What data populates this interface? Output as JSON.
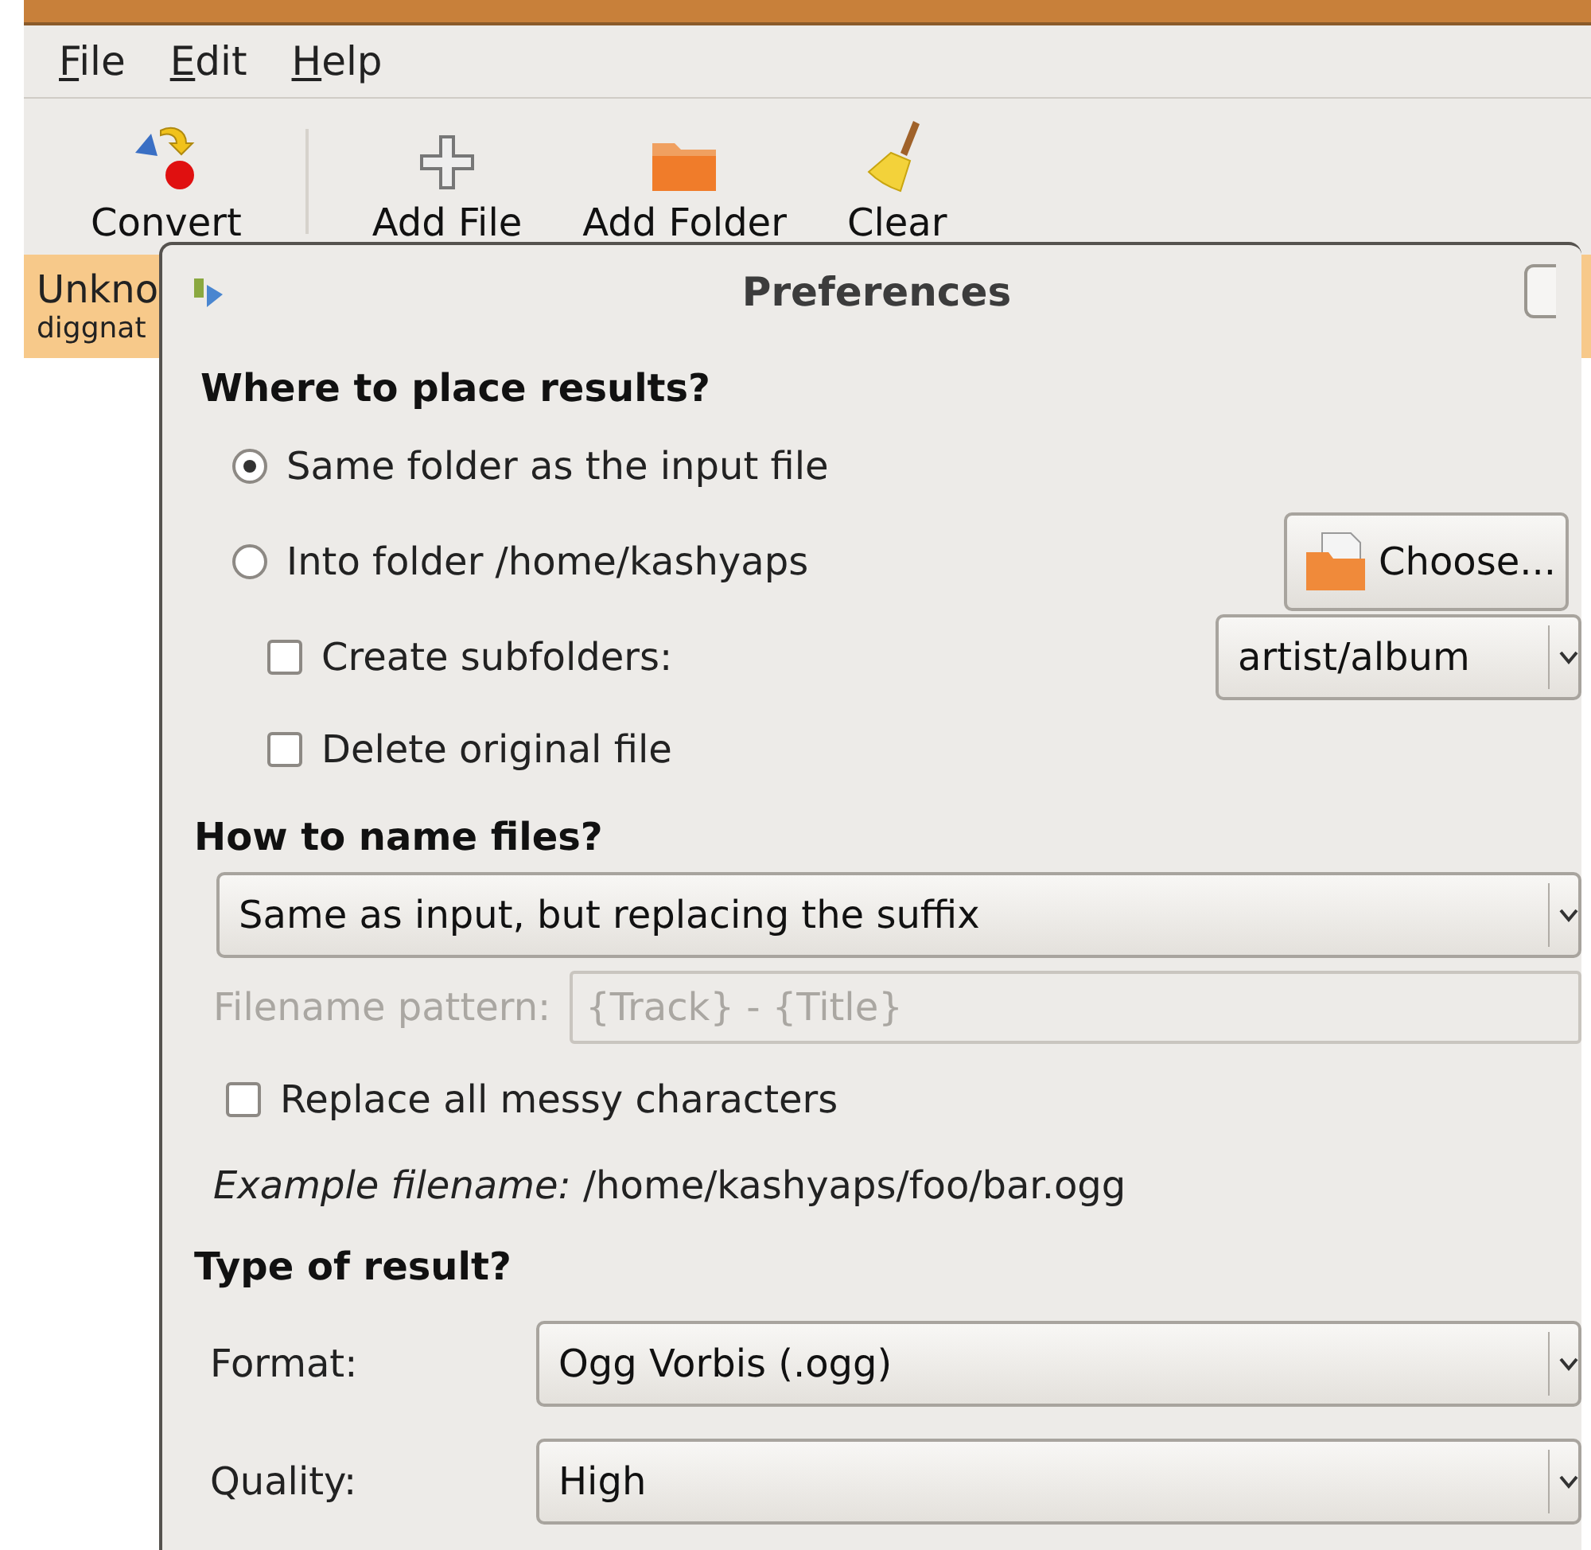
{
  "window": {
    "menu": [
      {
        "label": "File"
      },
      {
        "label": "Edit"
      },
      {
        "label": "Help"
      }
    ],
    "toolbar": [
      {
        "kind": "convert",
        "label": "Convert"
      },
      {
        "kind": "add",
        "label": "Add File"
      },
      {
        "kind": "folder",
        "label": "Add Folder"
      },
      {
        "kind": "clear",
        "label": "Clear"
      }
    ],
    "file_list": [
      {
        "title": "Unkno",
        "subtitle": "diggnat",
        "selected": true
      }
    ]
  },
  "dialog": {
    "title": "Preferences",
    "place_heading": "Where to place results?",
    "place_options": [
      {
        "label": "Same folder as the input file",
        "selected": true
      },
      {
        "label": "Into folder /home/kashyaps",
        "selected": false
      }
    ],
    "choose_button": "Choose...",
    "create_subfolders": {
      "label": "Create subfolders:",
      "checked": false,
      "value": "artist/album"
    },
    "delete_original": {
      "label": "Delete original file",
      "checked": false
    },
    "name_heading": "How to name files?",
    "name_scheme": "Same as input, but replacing the suffix",
    "pattern": {
      "label": "Filename pattern:",
      "value": "{Track} - {Title}",
      "disabled": true
    },
    "replace_messy": {
      "label": "Replace all messy characters",
      "checked": false
    },
    "example": "*Example filename:* /home/kashyaps/foo/bar.ogg",
    "type_heading": "Type of result?",
    "format": {
      "label": "Format:",
      "value": "Ogg Vorbis (.ogg)"
    },
    "quality": {
      "label": "Quality:",
      "value": "High"
    }
  }
}
